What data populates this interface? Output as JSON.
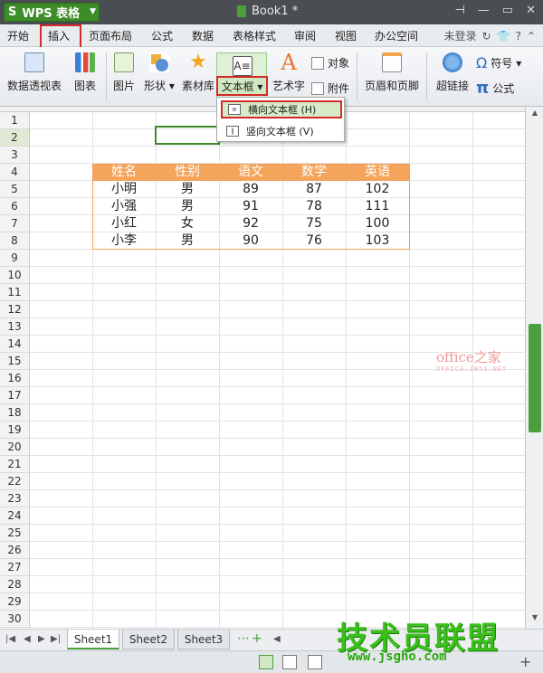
{
  "app": {
    "name": "WPS 表格",
    "logo": "S",
    "doc_title": "Book1 *"
  },
  "window_controls": [
    "pin-icon",
    "minimize-icon",
    "restore-icon",
    "close-icon"
  ],
  "menu": {
    "tabs": [
      "开始",
      "插入",
      "页面布局",
      "公式",
      "数据",
      "表格样式",
      "审阅",
      "视图",
      "办公空间"
    ],
    "active": "插入",
    "login": "未登录"
  },
  "ribbon": {
    "pivot": "数据透视表",
    "chart": "图表",
    "picture": "图片",
    "shapes": "形状",
    "material": "素材库",
    "textbox": "文本框",
    "wordart": "艺术字",
    "object": "对象",
    "attachment": "附件",
    "header_footer": "页眉和页脚",
    "hyperlink": "超链接",
    "symbol": "符号",
    "formula": "公式",
    "formula_glyph": "π",
    "symbol_glyph": "Ω",
    "wordart_glyph": "A"
  },
  "dropdown": {
    "items": [
      {
        "label": "横向文本框 (H)",
        "icon": "horizontal-textbox-icon"
      },
      {
        "label": "竖向文本框 (V)",
        "icon": "vertical-textbox-icon"
      }
    ]
  },
  "table": {
    "headers": [
      "姓名",
      "性别",
      "语文",
      "数学",
      "英语"
    ],
    "rows": [
      [
        "小明",
        "男",
        "89",
        "87",
        "102"
      ],
      [
        "小强",
        "男",
        "91",
        "78",
        "111"
      ],
      [
        "小红",
        "女",
        "92",
        "75",
        "100"
      ],
      [
        "小李",
        "男",
        "90",
        "76",
        "103"
      ]
    ]
  },
  "row_numbers": [
    "1",
    "2",
    "3",
    "4",
    "5",
    "6",
    "7",
    "8",
    "9",
    "10",
    "11",
    "12",
    "13",
    "14",
    "15",
    "16",
    "17",
    "18",
    "19",
    "20",
    "21",
    "22",
    "23",
    "24",
    "25",
    "26",
    "27",
    "28",
    "29",
    "30"
  ],
  "selected_row": "2",
  "sheets": {
    "tabs": [
      "Sheet1",
      "Sheet2",
      "Sheet3"
    ],
    "active": "Sheet1",
    "add": "+"
  },
  "watermarks": {
    "office": "office之家",
    "office_sub": "OFFICE.JB51.NET",
    "jsgho": "技术员联盟",
    "jsgho_sub": "www.jsgho.com"
  },
  "colors": {
    "accent": "#4aa03c",
    "table_header": "#f5a45b",
    "highlight_box": "#d32a2a"
  }
}
